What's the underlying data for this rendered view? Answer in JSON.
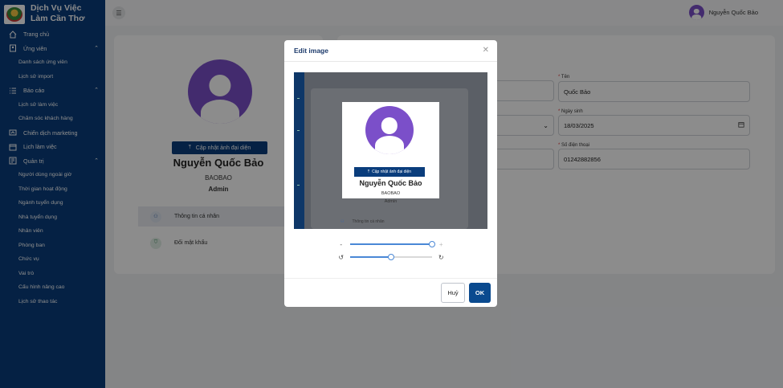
{
  "brand": {
    "name": "Dịch Vụ Việc Làm Cần Thơ"
  },
  "sidebar": {
    "items": [
      {
        "label": "Trang chủ",
        "icon": "home-icon"
      },
      {
        "label": "Ứng viên",
        "icon": "user-file-icon"
      },
      {
        "label": "Danh sách ứng viên"
      },
      {
        "label": "Lịch sử import"
      },
      {
        "label": "Báo cáo",
        "icon": "list-icon"
      },
      {
        "label": "Lịch sử làm việc"
      },
      {
        "label": "Chăm sóc khách hàng"
      },
      {
        "label": "Chiến dịch marketing",
        "icon": "campaign-icon"
      },
      {
        "label": "Lịch làm việc",
        "icon": "calendar-icon"
      },
      {
        "label": "Quản trị",
        "icon": "admin-icon"
      },
      {
        "label": "Người dùng ngoài giờ"
      },
      {
        "label": "Thời gian hoạt động"
      },
      {
        "label": "Ngành tuyển dụng"
      },
      {
        "label": "Nhà tuyển dụng"
      },
      {
        "label": "Nhân viên"
      },
      {
        "label": "Phòng ban"
      },
      {
        "label": "Chức vụ"
      },
      {
        "label": "Vai trò"
      },
      {
        "label": "Cấu hình nâng cao"
      },
      {
        "label": "Lịch sử thao tác"
      }
    ]
  },
  "topbar": {
    "user_name": "Nguyễn Quốc Bảo"
  },
  "profile": {
    "upload_label": "Cập nhật ảnh đại diện",
    "name": "Nguyễn Quốc Bảo",
    "username": "BAOBAO",
    "role": "Admin",
    "menu": [
      {
        "label": "Thông tin cá nhân"
      },
      {
        "label": "Đổi mật khẩu"
      }
    ]
  },
  "form": {
    "ten_label": "Tên",
    "ten_value": "Quốc Bảo",
    "ngaysinh_label": "Ngày sinh",
    "ngaysinh_value": "18/03/2025",
    "sdt_label": "Số điện thoại",
    "sdt_value": "01242882856"
  },
  "modal": {
    "title": "Edit image",
    "zoom_minus": "-",
    "zoom_plus": "+",
    "zoom_value": 1.0,
    "rotate_value": 0.5,
    "cancel_label": "Huỷ",
    "ok_label": "OK"
  },
  "colors": {
    "primary": "#0a3d7c",
    "avatar": "#7b4fc9",
    "slider": "#4a88d6"
  }
}
